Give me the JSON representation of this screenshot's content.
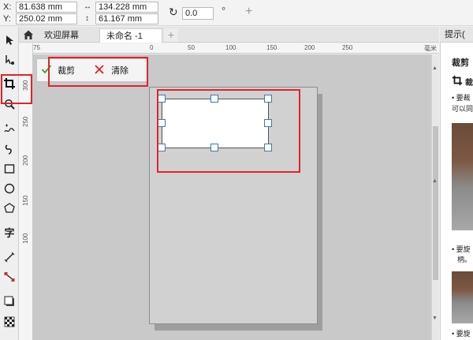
{
  "property_bar": {
    "x_label": "X:",
    "x_value": "81.638 mm",
    "y_label": "Y:",
    "y_value": "250.02 mm",
    "width_value": "134.228 mm",
    "height_value": "61.167 mm",
    "rotation_value": "0.0",
    "rotation_unit": "°",
    "add_label": "+"
  },
  "tabs": [
    {
      "label": "欢迎屏幕",
      "active": false
    },
    {
      "label": "未命名 -1",
      "active": true
    }
  ],
  "tab_add_label": "+",
  "toolbox": {
    "text_tool_label": "字"
  },
  "ruler": {
    "h_ticks": [
      "75",
      "0",
      "50",
      "100",
      "150",
      "200",
      "250"
    ],
    "units": "毫米",
    "v_ticks": [
      "300",
      "250",
      "200",
      "150",
      "100"
    ]
  },
  "crop_popup": {
    "crop_label": "裁剪",
    "clear_label": "清除"
  },
  "hints": {
    "title": "提示(",
    "heading": "裁剪",
    "tool_label": "裁",
    "line1": "• 要裁",
    "line2": "可以同",
    "line3": "• 要旋",
    "line4": "柄。",
    "line5": "• 要旋"
  },
  "colors": {
    "highlight": "#e0232b",
    "handle_border": "#3a7ab8",
    "canvas": "#c9c9c9"
  }
}
